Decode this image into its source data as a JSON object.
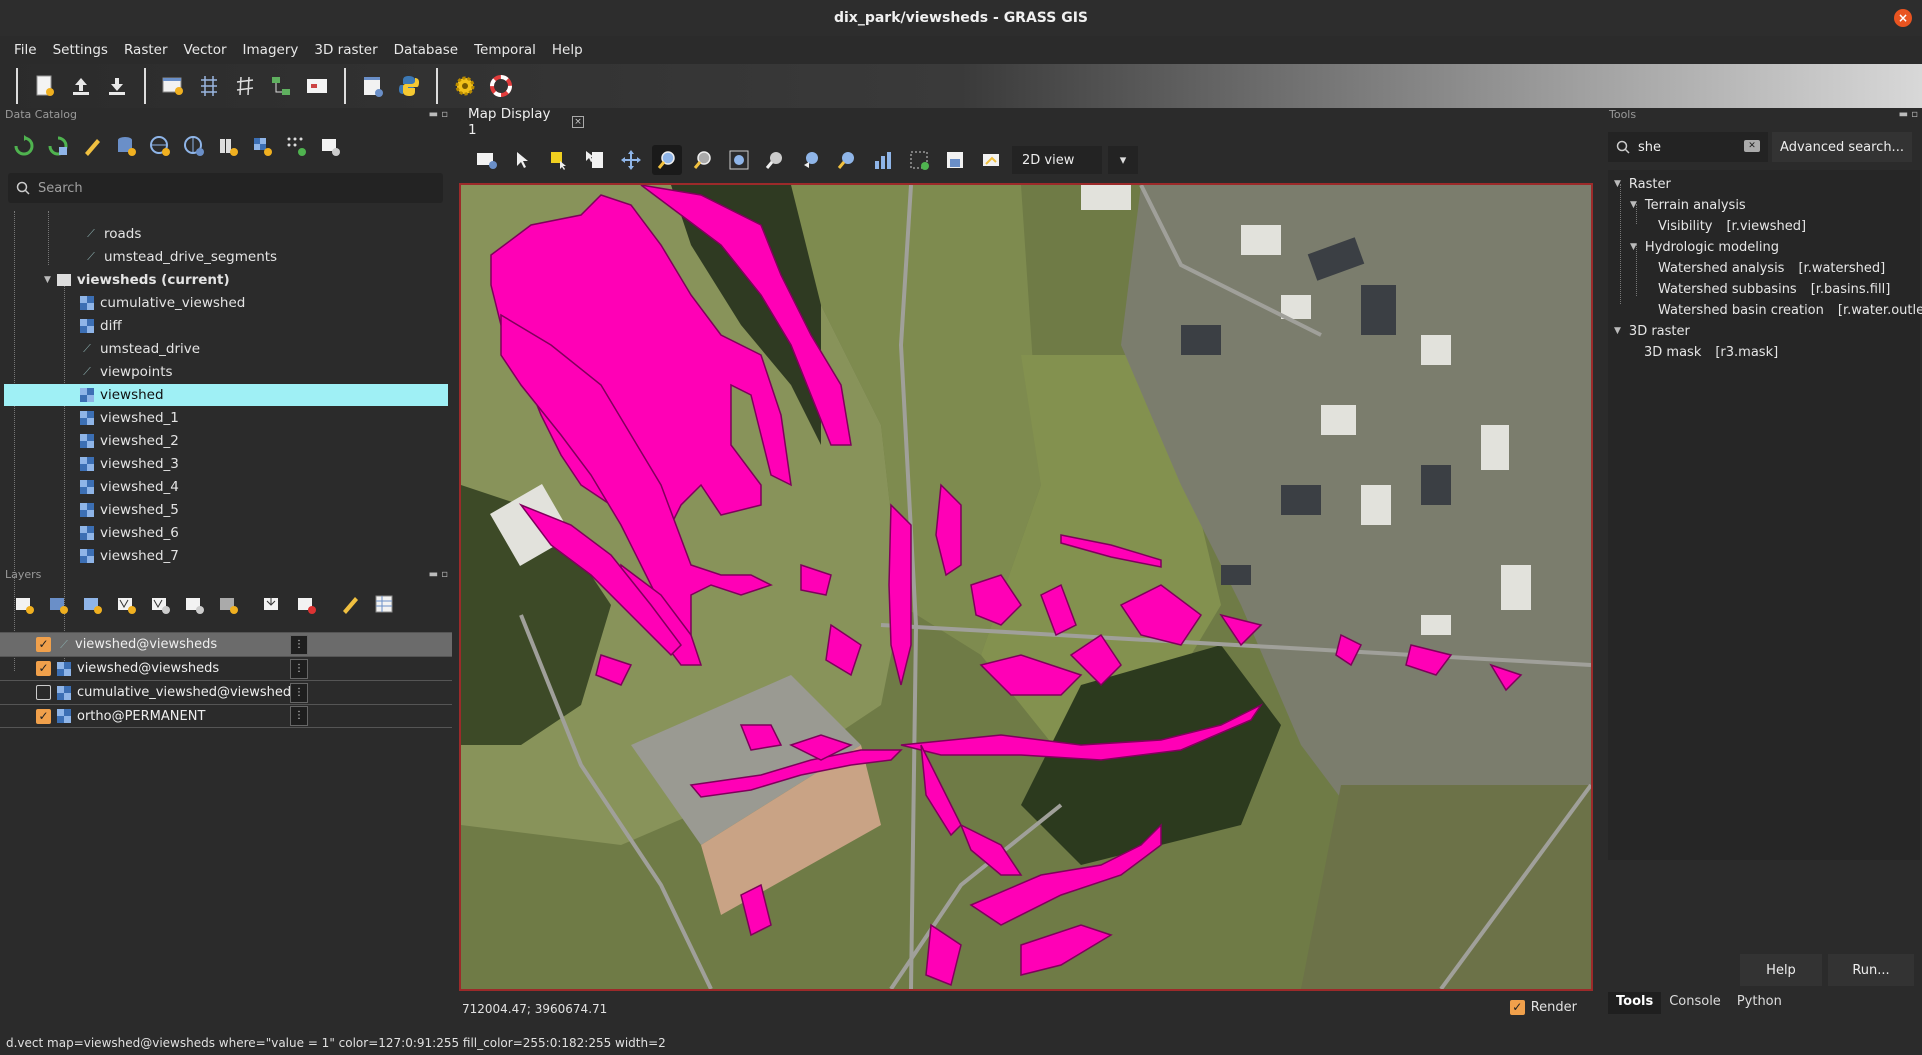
{
  "window": {
    "title": "dix_park/viewsheds - GRASS GIS",
    "close_glyph": "×"
  },
  "menu": [
    "File",
    "Settings",
    "Raster",
    "Vector",
    "Imagery",
    "3D raster",
    "Database",
    "Temporal",
    "Help"
  ],
  "data_catalog": {
    "caption": "Data Catalog",
    "search_placeholder": "Search",
    "tree": [
      {
        "label": "roads",
        "kind": "vector"
      },
      {
        "label": "umstead_drive_segments",
        "kind": "vector"
      },
      {
        "label": "viewsheds (current)",
        "kind": "mapset"
      },
      {
        "label": "cumulative_viewshed",
        "kind": "raster"
      },
      {
        "label": "diff",
        "kind": "raster"
      },
      {
        "label": "umstead_drive",
        "kind": "vector"
      },
      {
        "label": "viewpoints",
        "kind": "vector"
      },
      {
        "label": "viewshed",
        "kind": "raster",
        "selected": true
      },
      {
        "label": "viewshed_1",
        "kind": "raster"
      },
      {
        "label": "viewshed_2",
        "kind": "raster"
      },
      {
        "label": "viewshed_3",
        "kind": "raster"
      },
      {
        "label": "viewshed_4",
        "kind": "raster"
      },
      {
        "label": "viewshed_5",
        "kind": "raster"
      },
      {
        "label": "viewshed_6",
        "kind": "raster"
      },
      {
        "label": "viewshed_7",
        "kind": "raster"
      }
    ]
  },
  "layers": {
    "caption": "Layers",
    "items": [
      {
        "label": "viewshed@viewsheds",
        "checked": true,
        "kind": "vector",
        "selected": true
      },
      {
        "label": "viewshed@viewsheds",
        "checked": true,
        "kind": "raster"
      },
      {
        "label": "cumulative_viewshed@viewsheds",
        "checked": false,
        "kind": "raster"
      },
      {
        "label": "ortho@PERMANENT",
        "checked": true,
        "kind": "raster"
      }
    ]
  },
  "map_display": {
    "tab_label": "Map Display 1",
    "view_mode": "2D view",
    "coordinates": "712004.47; 3960674.71",
    "render_label": "Render",
    "render_checked": true
  },
  "tools": {
    "caption": "Tools",
    "search_value": "she",
    "advanced_search_label": "Advanced search...",
    "tree": [
      {
        "label": "Raster",
        "module": ""
      },
      {
        "label": "Terrain analysis",
        "module": ""
      },
      {
        "label": "Visibility",
        "module": "[r.viewshed]"
      },
      {
        "label": "Hydrologic modeling",
        "module": ""
      },
      {
        "label": "Watershed analysis",
        "module": "[r.watershed]"
      },
      {
        "label": "Watershed subbasins",
        "module": "[r.basins.fill]"
      },
      {
        "label": "Watershed basin creation",
        "module": "[r.water.outle"
      },
      {
        "label": "3D raster",
        "module": ""
      },
      {
        "label": "3D mask",
        "module": "[r3.mask]"
      }
    ],
    "help_label": "Help",
    "run_label": "Run...",
    "tabs": [
      "Tools",
      "Console",
      "Python"
    ]
  },
  "status_command": "d.vect map=viewshed@viewsheds where=\"value = 1\" color=127:0:91:255 fill_color=255:0:182:255 width=2",
  "colors": {
    "viewshed_fill": "#ff00b6",
    "viewshed_outline": "#7f005b",
    "selection": "#9ff0f5",
    "checkbox": "#f0a04b",
    "map_border": "#9c2a2a"
  }
}
